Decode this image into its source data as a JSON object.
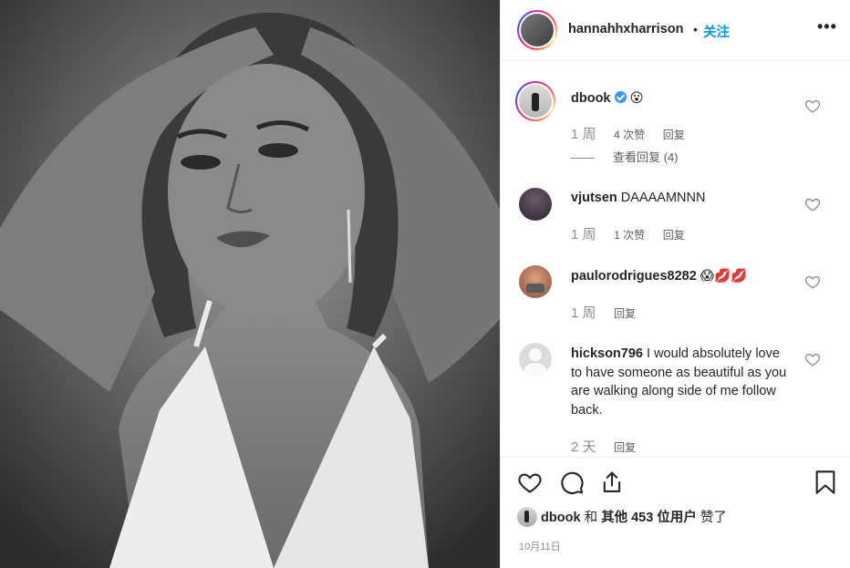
{
  "post": {
    "author": "hannahhxharrison",
    "dot": "•",
    "follow_label": "关注",
    "more_label": "•••",
    "date": "10月11日"
  },
  "comments": [
    {
      "user": "dbook",
      "verified": true,
      "text": "😮",
      "time": "1 周",
      "likes": "4 次赞",
      "reply": "回复",
      "view_replies": "查看回复 (4)"
    },
    {
      "user": "vjutsen",
      "text": "DAAAAMNNN",
      "time": "1 周",
      "likes": "1 次赞",
      "reply": "回复"
    },
    {
      "user": "paulorodrigues8282",
      "text": "😱💋💋",
      "time": "1 周",
      "reply": "回复"
    },
    {
      "user": "hickson796",
      "text": "I would absolutely love to have someone as beautiful as you are walking along side of me follow back.",
      "time": "2 天",
      "reply": "回复"
    }
  ],
  "likes_line": {
    "user": "dbook",
    "and": "和",
    "others": "其他 453 位用户",
    "suffix": "赞了"
  },
  "icons": {
    "like": "heart-icon",
    "comment": "comment-icon",
    "share": "share-icon",
    "save": "bookmark-icon"
  },
  "colors": {
    "follow_blue": "#0095f6",
    "verified_blue": "#3897f0",
    "meta_gray": "#8e8e8e"
  }
}
